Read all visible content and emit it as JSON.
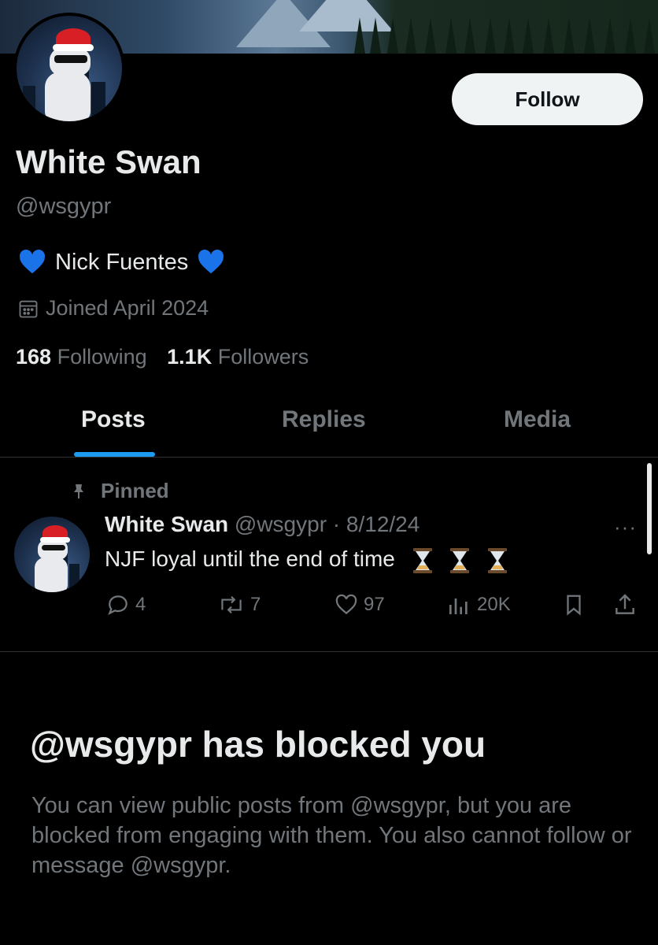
{
  "profile": {
    "display_name": "White Swan",
    "handle": "@wsgypr",
    "follow_label": "Follow",
    "bio_text": "Nick Fuentes",
    "joined": "Joined April 2024",
    "following_count": "168",
    "following_label": "Following",
    "followers_count": "1.1K",
    "followers_label": "Followers"
  },
  "tabs": [
    {
      "label": "Posts",
      "active": true
    },
    {
      "label": "Replies",
      "active": false
    },
    {
      "label": "Media",
      "active": false
    }
  ],
  "pinned_post": {
    "pinned_label": "Pinned",
    "author_name": "White Swan",
    "meta": "@wsgypr · 8/12/24",
    "text": "NJF loyal until the end of time",
    "more": "···",
    "replies": "4",
    "reposts": "7",
    "likes": "97",
    "views": "20K",
    "emoji_count_icons": "hourglass-icon"
  },
  "blocked": {
    "title": "@wsgypr has blocked you",
    "message": "You can view public posts from @wsgypr, but you are blocked from engaging with them. You also cannot follow or message @wsgypr."
  },
  "colors": {
    "background": "#000000",
    "text_primary": "#e7e9ea",
    "text_secondary": "#71767b",
    "accent": "#1d9bf0",
    "heart_blue": "#1a73e8",
    "divider": "#2f3336"
  }
}
